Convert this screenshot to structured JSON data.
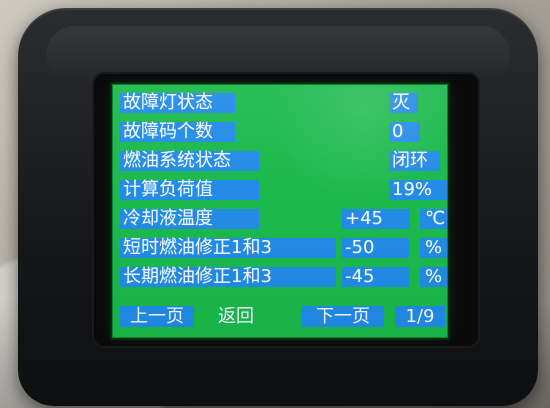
{
  "rows": [
    {
      "label": "故障灯状态",
      "value": "灭",
      "unit": ""
    },
    {
      "label": "故障码个数",
      "value": "0",
      "unit": ""
    },
    {
      "label": "燃油系统状态",
      "value": "闭环",
      "unit": ""
    },
    {
      "label": "计算负荷值",
      "value": "19%",
      "unit": ""
    },
    {
      "label": "冷却液温度",
      "value": "+45",
      "unit": "℃"
    },
    {
      "label": "短时燃油修正1和3",
      "value": "-50",
      "unit": "%"
    },
    {
      "label": "长期燃油修正1和3",
      "value": "-45",
      "unit": "%"
    }
  ],
  "footer": {
    "prev": "上一页",
    "back": "返回",
    "next": "下一页",
    "page": "1/9"
  },
  "colors": {
    "screen_bg": "#18b84a",
    "field_bg": "#208ae6",
    "text": "#f5fbff",
    "device": "#16181b"
  }
}
